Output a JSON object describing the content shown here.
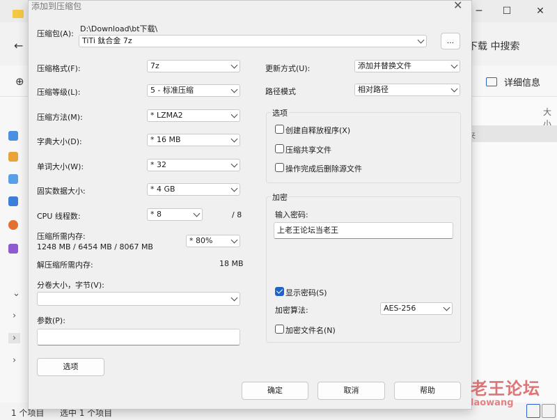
{
  "explorer": {
    "search_text": "下载 中搜索",
    "details_label": "详细信息",
    "column_header": "大小",
    "selected_row_text": "夹",
    "status_items": "1 个项目",
    "status_selected": "选中 1 个项目",
    "minimize": "─",
    "maximize": "☐",
    "close": "✕",
    "back": "←",
    "new": "⊕"
  },
  "watermark": {
    "main": "老王论坛",
    "url": "laowang"
  },
  "dialog": {
    "title": "添加到压缩包",
    "close": "✕",
    "archive_label": "压缩包(A):",
    "archive_path": "D:\\Download\\bt下载\\",
    "archive_name": "TiTi 鈦合金 7z",
    "browse_button": "...",
    "format_label": "压缩格式(F):",
    "format_value": "7z",
    "level_label": "压缩等级(L):",
    "level_value": "5 - 标准压缩",
    "method_label": "压缩方法(M):",
    "method_value": "* LZMA2",
    "dict_label": "字典大小(D):",
    "dict_value": "* 16 MB",
    "word_label": "单词大小(W):",
    "word_value": "* 32",
    "solid_label": "固实数据大小:",
    "solid_value": "* 4 GB",
    "threads_label": "CPU 线程数:",
    "threads_value": "* 8",
    "threads_max": "/ 8",
    "mem_label": "压缩所需内存:",
    "mem_detail": "1248 MB / 6454 MB / 8067 MB",
    "mem_value": "* 80%",
    "decomp_label": "解压缩所需内存:",
    "decomp_value": "18 MB",
    "volume_label": "分卷大小，字节(V):",
    "volume_value": "",
    "params_label": "参数(P):",
    "params_value": "",
    "options_button": "选项",
    "update_label": "更新方式(U):",
    "update_value": "添加并替换文件",
    "pathmode_label": "路径模式",
    "pathmode_value": "相对路径",
    "options_group": "选项",
    "opt_sfx": "创建自释放程序(X)",
    "opt_shared": "压缩共享文件",
    "opt_delete": "操作完成后删除源文件",
    "enc_group": "加密",
    "password_label": "输入密码:",
    "password_value": "上老王论坛当老王",
    "show_password": "显示密码(S)",
    "enc_method_label": "加密算法:",
    "enc_method_value": "AES-256",
    "encrypt_names": "加密文件名(N)",
    "ok_button": "确定",
    "cancel_button": "取消",
    "help_button": "帮助"
  },
  "colors": {
    "accent": "#1e63c8",
    "watermark": "#d24a4a"
  }
}
